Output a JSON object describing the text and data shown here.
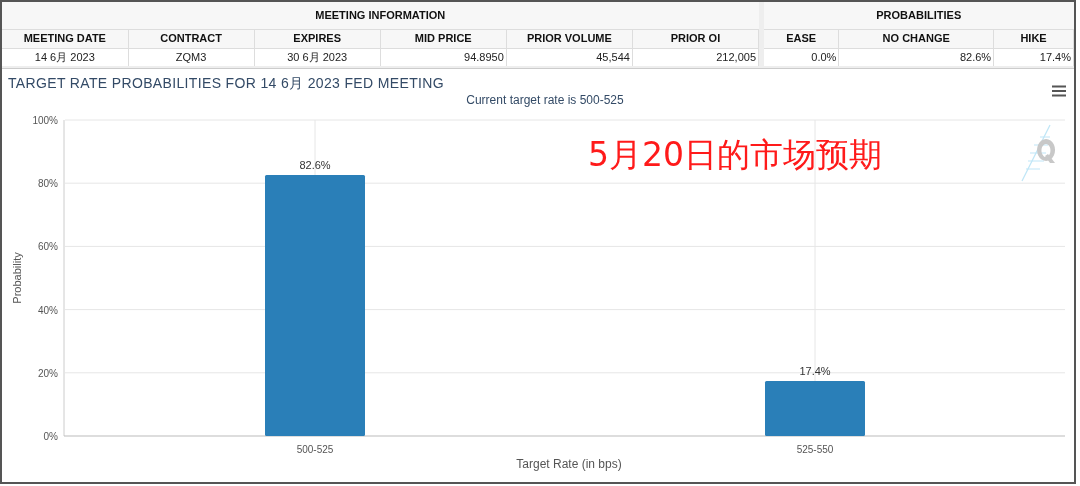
{
  "meeting_information": {
    "title": "MEETING INFORMATION",
    "columns": [
      "MEETING DATE",
      "CONTRACT",
      "EXPIRES",
      "MID PRICE",
      "PRIOR VOLUME",
      "PRIOR OI"
    ],
    "row": [
      "14 6月 2023",
      "ZQM3",
      "30 6月 2023",
      "94.8950",
      "45,544",
      "212,005"
    ]
  },
  "probabilities": {
    "title": "PROBABILITIES",
    "columns": [
      "EASE",
      "NO CHANGE",
      "HIKE"
    ],
    "row": [
      "0.0%",
      "82.6%",
      "17.4%"
    ]
  },
  "chart": {
    "title": "TARGET RATE PROBABILITIES FOR 14 6月 2023 FED MEETING",
    "subtitle": "Current target rate is 500-525",
    "annotation": "5月20日的市场预期",
    "chart_data": {
      "type": "bar",
      "xlabel": "Target Rate (in bps)",
      "ylabel": "Probability",
      "categories": [
        "500-525",
        "525-550"
      ],
      "series": [
        {
          "color": "#2a7fb8",
          "values": [
            82.6,
            17.4
          ]
        }
      ],
      "grid": true,
      "ylim": [
        0,
        100
      ],
      "yticks": [
        {
          "value": 0,
          "label": "0%"
        },
        {
          "value": 20,
          "label": "20%"
        },
        {
          "value": 40,
          "label": "40%"
        },
        {
          "value": 60,
          "label": "60%"
        },
        {
          "value": 80,
          "label": "80%"
        },
        {
          "value": 100,
          "label": "100%"
        }
      ],
      "value_labels": [
        "82.6%",
        "17.4%"
      ]
    }
  }
}
